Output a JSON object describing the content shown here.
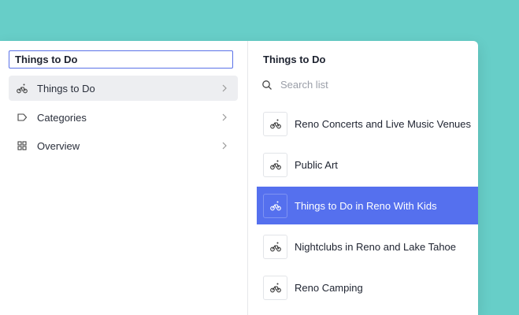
{
  "left_panel": {
    "title_value": "Things to Do",
    "nav": [
      {
        "label": "Things to Do",
        "icon": "bike-icon"
      },
      {
        "label": "Categories",
        "icon": "tag-icon"
      },
      {
        "label": "Overview",
        "icon": "grid-icon"
      }
    ]
  },
  "right_panel": {
    "title": "Things to Do",
    "search_placeholder": "Search list",
    "items": [
      {
        "label": "Reno Concerts and Live Music Venues"
      },
      {
        "label": "Public Art"
      },
      {
        "label": "Things to Do in Reno With Kids"
      },
      {
        "label": "Nightclubs in Reno and Lake Tahoe"
      },
      {
        "label": "Reno Camping"
      }
    ]
  },
  "colors": {
    "background": "#67cec8",
    "accent": "#5570ee",
    "focus_border": "#5a72e8"
  }
}
